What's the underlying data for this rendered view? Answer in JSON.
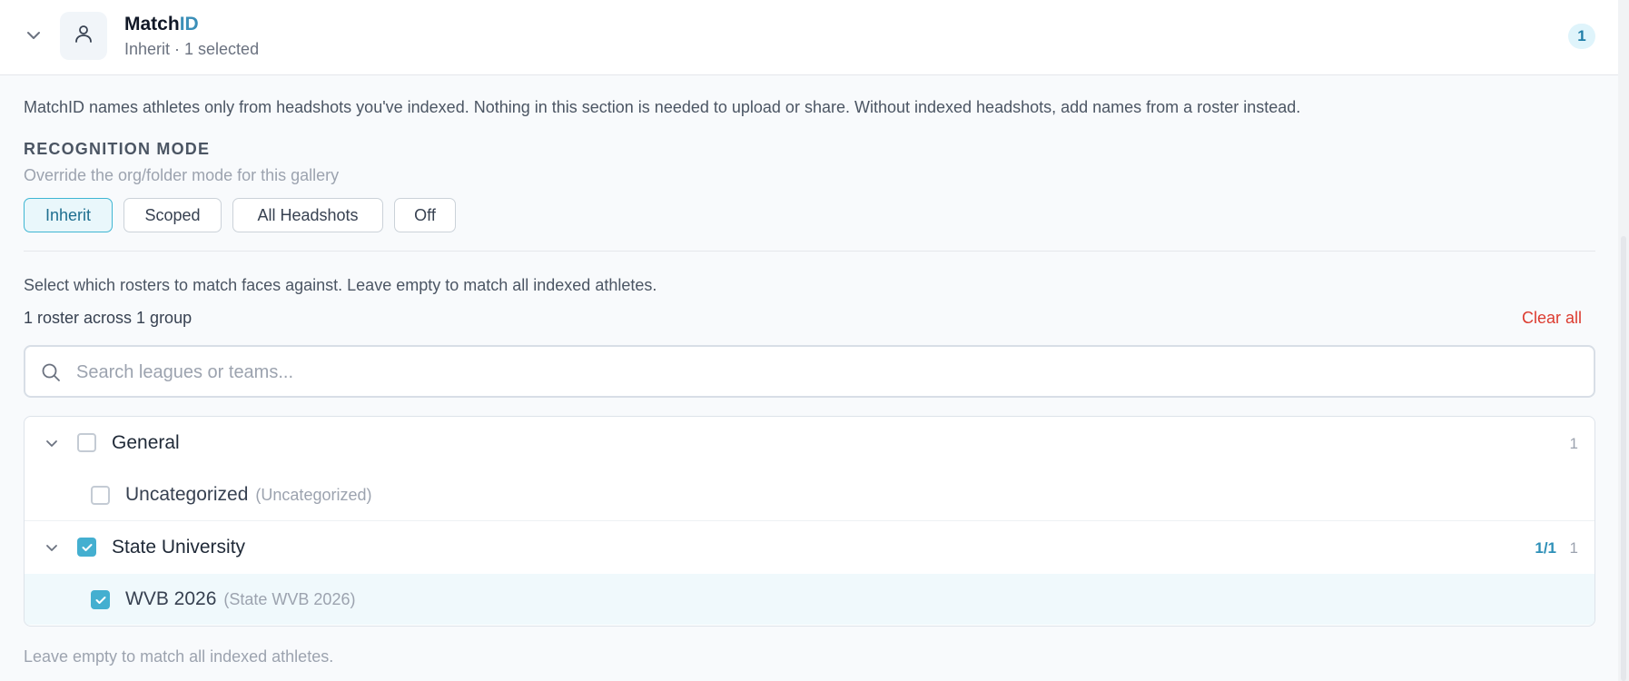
{
  "header": {
    "title_main": "Match",
    "title_accent": "ID",
    "subtitle": "Inherit · 1 selected",
    "badge_count": "1"
  },
  "intro": "MatchID names athletes only from headshots you've indexed. Nothing in this section is needed to upload or share. Without indexed headshots, add names from a roster instead.",
  "recognition": {
    "title": "RECOGNITION MODE",
    "subtitle": "Override the org/folder mode for this gallery",
    "options": [
      "Inherit",
      "Scoped",
      "All Headshots",
      "Off"
    ],
    "selected": "Inherit"
  },
  "rosters": {
    "help": "Select which rosters to match faces against. Leave empty to match all indexed athletes.",
    "summary": "1 roster across 1 group",
    "clear_all": "Clear all",
    "search_placeholder": "Search leagues or teams...",
    "search_value": "",
    "groups": [
      {
        "name": "General",
        "checked": false,
        "count": "1",
        "ratio": "",
        "children": [
          {
            "name": "Uncategorized",
            "code": "(Uncategorized)",
            "checked": false
          }
        ]
      },
      {
        "name": "State University",
        "checked": true,
        "count": "1",
        "ratio": "1/1",
        "children": [
          {
            "name": "WVB 2026",
            "code": "(State WVB 2026)",
            "checked": true
          }
        ]
      }
    ],
    "footer": "Leave empty to match all indexed athletes."
  },
  "colors": {
    "accent": "#3b8fb8",
    "checkbox_checked": "#44afd0",
    "danger": "#dc3b2f",
    "selected_row_bg": "#f0f9fc"
  },
  "icons": {
    "collapse": "chevron-down-icon",
    "avatar": "user-icon",
    "search": "search-icon",
    "check": "check-icon"
  }
}
